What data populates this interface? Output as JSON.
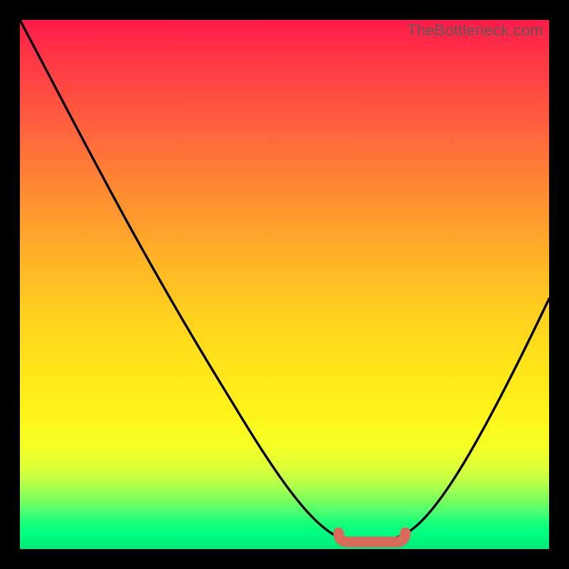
{
  "watermark": "TheBottleneck.com",
  "colors": {
    "frame": "#000000",
    "curve": "#000000",
    "marker_fill": "#d96a5b",
    "marker_stroke": "#b64c3e",
    "gradient_top": "#ff1a49",
    "gradient_bottom": "#00e97a"
  },
  "chart_data": {
    "type": "line",
    "title": "",
    "xlabel": "",
    "ylabel": "",
    "xlim": [
      0,
      100
    ],
    "ylim": [
      0,
      100
    ],
    "grid": false,
    "legend": false,
    "series": [
      {
        "name": "curve",
        "x": [
          0,
          20,
          40,
          55,
          60,
          65,
          70,
          75,
          85,
          100
        ],
        "y": [
          100,
          70,
          40,
          15,
          5,
          2,
          2,
          4,
          18,
          48
        ]
      }
    ],
    "markers": {
      "name": "optimal-range",
      "x_range": [
        61,
        72
      ],
      "y": 1.5,
      "thickness": 2.2
    },
    "annotations": []
  }
}
